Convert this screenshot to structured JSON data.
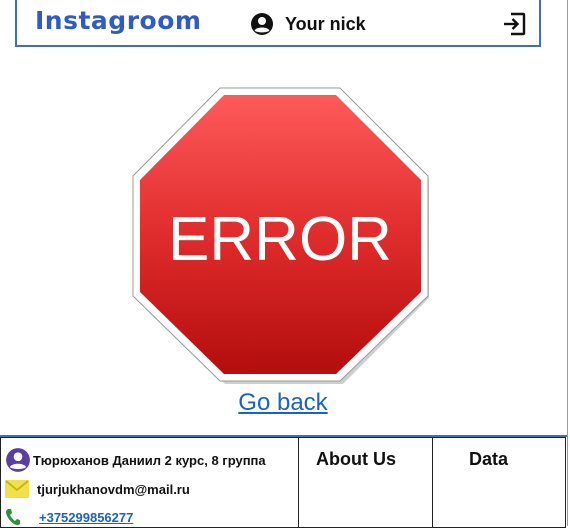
{
  "header": {
    "logo": "Instagroom",
    "nick": "Your nick",
    "user_icon": "account-circle-icon",
    "logout_icon": "logout-icon"
  },
  "error": {
    "sign_text": "ERROR",
    "sign_icon": "stop-sign-icon",
    "go_back": "Go back"
  },
  "footer": {
    "author": "Тюрюханов Даниил  2 курс, 8 группа",
    "email": "tjurjukhanovdm@mail.ru",
    "phone": "+375299856277",
    "about": "About Us",
    "data": "Data",
    "icons": [
      "account-circle-icon",
      "mail-icon",
      "phone-icon"
    ]
  },
  "colors": {
    "brand": "#2f5cc4",
    "border": "#3f6fbf",
    "sign_red": "#d42a2a",
    "link": "#1a62c8",
    "mail_yellow": "#f2e04a",
    "phone_green": "#2f8f3a"
  }
}
